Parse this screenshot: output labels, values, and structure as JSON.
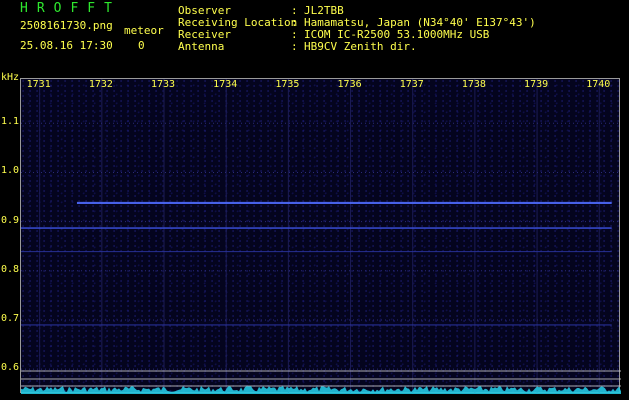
{
  "app_name": "HROFFT",
  "filename": "2508161730.png",
  "datetime": "25.08.16 17:30",
  "mode_label": "meteor",
  "count": "0",
  "station_info": [
    {
      "key": "Observer",
      "value": "JL2TBB"
    },
    {
      "key": "Receiving Location",
      "value": "Hamamatsu, Japan (N34°40' E137°43')"
    },
    {
      "key": "Receiver",
      "value": "ICOM IC-R2500 53.1000MHz USB"
    },
    {
      "key": "Antenna",
      "value": "HB9CV Zenith dir."
    }
  ],
  "separator": ":",
  "chart_data": {
    "type": "heatmap",
    "ylabel": "kHz",
    "x_ticks": [
      "1731",
      "1732",
      "1733",
      "1734",
      "1735",
      "1736",
      "1737",
      "1738",
      "1739",
      "1740"
    ],
    "y_ticks": [
      "1.1",
      "1.0",
      "0.9",
      "0.8",
      "0.7",
      "0.6"
    ],
    "xlim": [
      1730.7,
      1740.35
    ],
    "ylim": [
      0.58,
      1.19
    ],
    "traces": [
      {
        "name": "",
        "freq_khz": 0.938,
        "from": 1731.6,
        "to": 1740.2,
        "strength": "strong"
      },
      {
        "name": "",
        "freq_khz": 0.887,
        "from": 1730.7,
        "to": 1740.2,
        "strength": "medium"
      },
      {
        "name": "",
        "freq_khz": 0.839,
        "from": 1730.7,
        "to": 1740.2,
        "strength": "weak"
      },
      {
        "name": "",
        "freq_khz": 0.69,
        "from": 1730.7,
        "to": 1740.2,
        "strength": "weak"
      }
    ],
    "colors": {
      "background": "#04041e",
      "trace_strong": "#4f6bff",
      "trace_medium": "#3a4fd8",
      "trace_weak": "#2a34a0",
      "baseline": "#c8c8c8",
      "spectrum": "#23c8e0",
      "text": "#ffff4d",
      "title": "#2ee82e"
    }
  }
}
